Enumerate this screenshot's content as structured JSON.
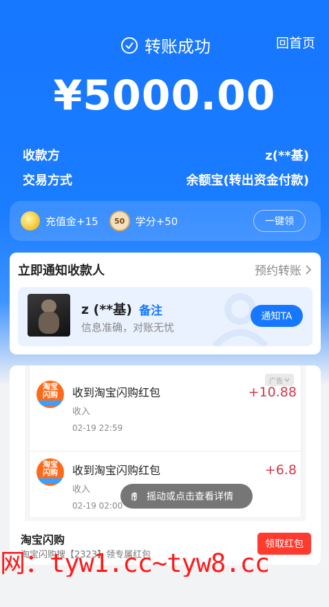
{
  "header": {
    "status_text": "转账成功",
    "home_link": "回首页",
    "amount": "¥5000.00"
  },
  "info": [
    {
      "label": "收款方",
      "value": "z(**基)"
    },
    {
      "label": "交易方式",
      "value": "余额宝(转出资金付款)"
    }
  ],
  "rewards": {
    "recharge": "充值金+15",
    "score_badge": "50",
    "score": "学分+50",
    "claim_button": "一键领"
  },
  "notify": {
    "title": "立即通知收款人",
    "schedule_link": "预约转账",
    "receiver_name": "z (**基)",
    "remark": "备注",
    "subtitle": "信息准确，对账无忧",
    "notify_button": "通知TA"
  },
  "ad": {
    "badge": "广告",
    "transactions": [
      {
        "logo_line1": "淘宝",
        "logo_line2": "闪购",
        "title": "收到淘宝闪购红包",
        "type": "收入",
        "time": "02-19 22:59",
        "amount": "+10.88"
      },
      {
        "logo_line1": "淘宝",
        "logo_line2": "闪购",
        "title": "收到淘宝闪购红包",
        "type": "收入",
        "time": "02-19 02:00",
        "amount": "+6.8"
      }
    ],
    "toast": "摇动或点击查看详情",
    "title": "淘宝闪购",
    "subtitle": "淘宝闪购搜【2323】领专属红包",
    "cta_button": "领取红包"
  },
  "watermark": "网：tyw1.cc~tyw8.cc",
  "colors": {
    "primary_blue": "#1677ff",
    "ad_red": "#ff3b30",
    "amount_red": "#d0374a",
    "watermark_red": "#ff1a1a"
  }
}
